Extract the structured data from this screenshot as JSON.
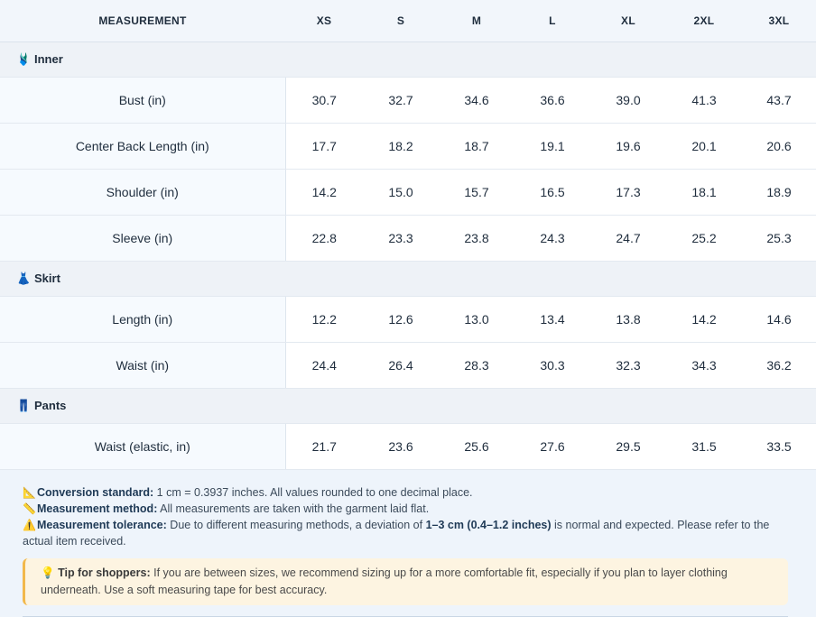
{
  "header": {
    "measurement": "MEASUREMENT",
    "sizes": [
      "XS",
      "S",
      "M",
      "L",
      "XL",
      "2XL",
      "3XL"
    ]
  },
  "sections": [
    {
      "icon": "🩱",
      "icon_name": "top-garment-icon",
      "title": "Inner",
      "rows": [
        {
          "label": "Bust (in)",
          "values": [
            "30.7",
            "32.7",
            "34.6",
            "36.6",
            "39.0",
            "41.3",
            "43.7"
          ]
        },
        {
          "label": "Center Back Length (in)",
          "values": [
            "17.7",
            "18.2",
            "18.7",
            "19.1",
            "19.6",
            "20.1",
            "20.6"
          ]
        },
        {
          "label": "Shoulder (in)",
          "values": [
            "14.2",
            "15.0",
            "15.7",
            "16.5",
            "17.3",
            "18.1",
            "18.9"
          ]
        },
        {
          "label": "Sleeve (in)",
          "values": [
            "22.8",
            "23.3",
            "23.8",
            "24.3",
            "24.7",
            "25.2",
            "25.3"
          ]
        }
      ]
    },
    {
      "icon": "👗",
      "icon_name": "dress-icon",
      "title": "Skirt",
      "rows": [
        {
          "label": "Length (in)",
          "values": [
            "12.2",
            "12.6",
            "13.0",
            "13.4",
            "13.8",
            "14.2",
            "14.6"
          ]
        },
        {
          "label": "Waist (in)",
          "values": [
            "24.4",
            "26.4",
            "28.3",
            "30.3",
            "32.3",
            "34.3",
            "36.2"
          ]
        }
      ]
    },
    {
      "icon": "👖",
      "icon_name": "pants-icon",
      "title": "Pants",
      "rows": [
        {
          "label": "Waist (elastic, in)",
          "values": [
            "21.7",
            "23.6",
            "25.6",
            "27.6",
            "29.5",
            "31.5",
            "33.5"
          ]
        }
      ]
    }
  ],
  "notes": {
    "conversion": {
      "icon": "📐",
      "label": "Conversion standard:",
      "text": " 1 cm = 0.3937 inches. All values rounded to one decimal place."
    },
    "method": {
      "icon": "📏",
      "label": "Measurement method:",
      "text": " All measurements are taken with the garment laid flat."
    },
    "tolerance": {
      "icon": "⚠️",
      "label": "Measurement tolerance:",
      "text_before": " Due to different measuring methods, a deviation of ",
      "bold": "1–3 cm (0.4–1.2 inches)",
      "text_after": " is normal and expected. Please refer to the actual item received."
    }
  },
  "tip": {
    "icon": "💡",
    "label": "Tip for shoppers:",
    "text": " If you are between sizes, we recommend sizing up for a more comfortable fit, especially if you plan to layer clothing underneath. Use a soft measuring tape for best accuracy."
  }
}
